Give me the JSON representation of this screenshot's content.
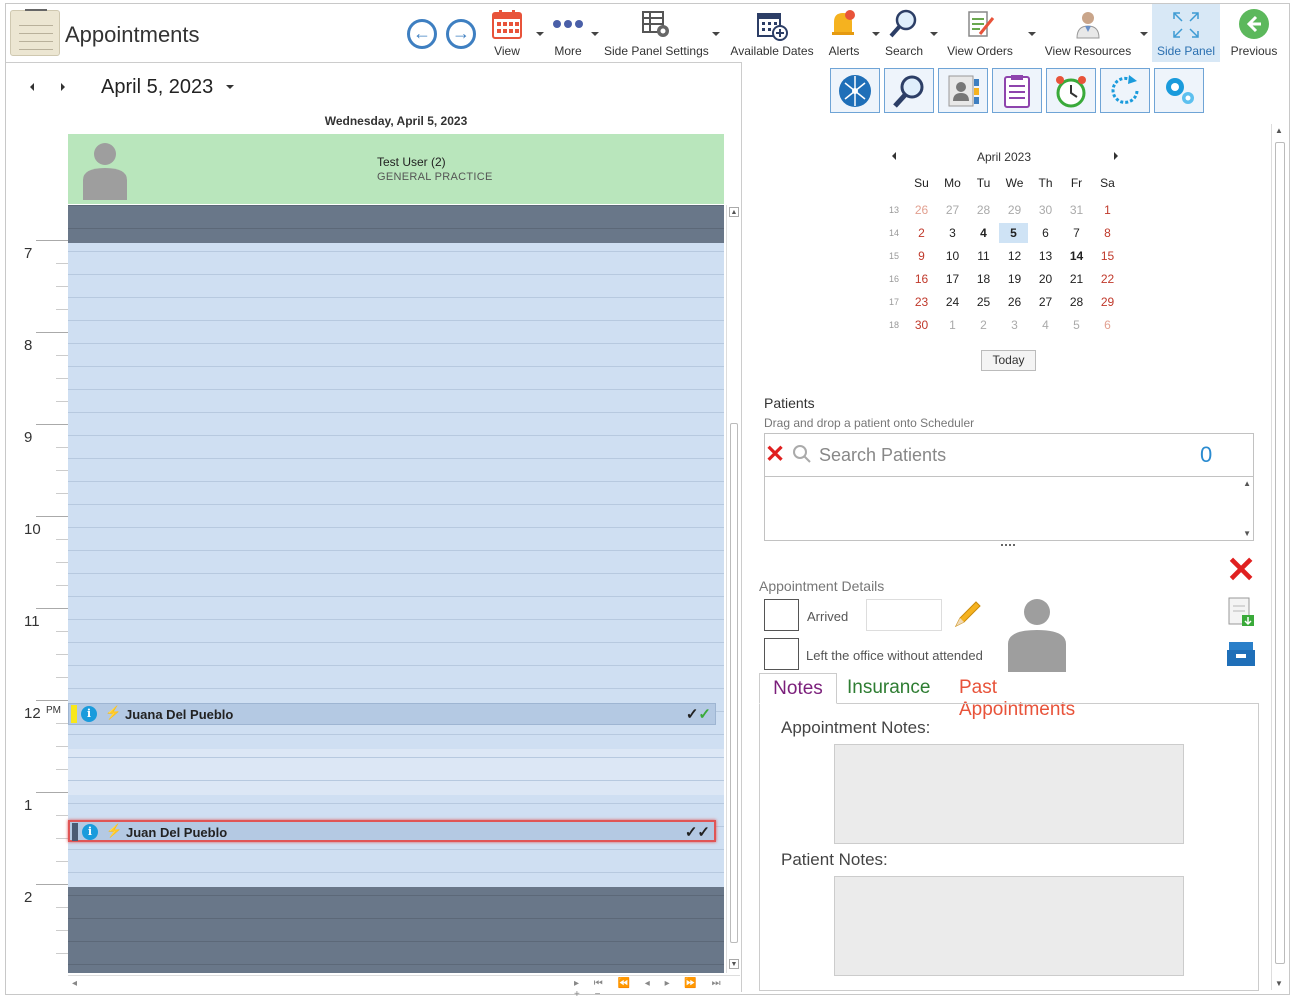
{
  "app": {
    "title": "Appointments"
  },
  "toolbar": {
    "view": "View",
    "more": "More",
    "side_panel_settings": "Side Panel Settings",
    "available_dates": "Available Dates",
    "alerts": "Alerts",
    "search": "Search",
    "view_orders": "View Orders",
    "view_resources": "View Resources",
    "side_panel": "Side Panel",
    "previous": "Previous"
  },
  "scheduler": {
    "date": "April 5, 2023",
    "day_header": "Wednesday, April 5, 2023",
    "resource_name": "Test User (2)",
    "resource_practice": "GENERAL PRACTICE",
    "hours": [
      "7",
      "8",
      "9",
      "10",
      "11",
      "12",
      "1",
      "2"
    ],
    "pm_marker": "PM",
    "appointments": [
      {
        "name": "Juana Del Pueblo",
        "status_color": "#f8e71c"
      },
      {
        "name": "Juan Del Pueblo",
        "status_color": "#4a5a73"
      }
    ]
  },
  "mini_calendar": {
    "title": "April 2023",
    "weekdays": [
      "Su",
      "Mo",
      "Tu",
      "We",
      "Th",
      "Fr",
      "Sa"
    ],
    "week_numbers": [
      "13",
      "14",
      "15",
      "16",
      "17",
      "18"
    ],
    "days": [
      [
        "26",
        "27",
        "28",
        "29",
        "30",
        "31",
        "1"
      ],
      [
        "2",
        "3",
        "4",
        "5",
        "6",
        "7",
        "8"
      ],
      [
        "9",
        "10",
        "11",
        "12",
        "13",
        "14",
        "15"
      ],
      [
        "16",
        "17",
        "18",
        "19",
        "20",
        "21",
        "22"
      ],
      [
        "23",
        "24",
        "25",
        "26",
        "27",
        "28",
        "29"
      ],
      [
        "30",
        "1",
        "2",
        "3",
        "4",
        "5",
        "6"
      ]
    ],
    "today_label": "Today"
  },
  "patients": {
    "label": "Patients",
    "hint": "Drag and drop a patient onto Scheduler",
    "search_placeholder": "Search Patients",
    "count": "0"
  },
  "appointment_details": {
    "label": "Appointment Details",
    "arrived_label": "Arrived",
    "left_label": "Left the office without attended"
  },
  "tabs": {
    "notes": "Notes",
    "insurance": "Insurance",
    "past": "Past Appointments"
  },
  "notes_panel": {
    "appointment_notes_label": "Appointment Notes:",
    "patient_notes_label": "Patient Notes:"
  },
  "colors": {
    "accent": "#3e7fc1",
    "resource_bg": "#b9e6bc",
    "grid_bg": "#cfdff2",
    "off_hours": "#697789",
    "weekend": "#c0392b",
    "tab_notes": "#7b1f7b",
    "tab_insurance": "#2e7d32",
    "tab_past": "#e8533a"
  }
}
